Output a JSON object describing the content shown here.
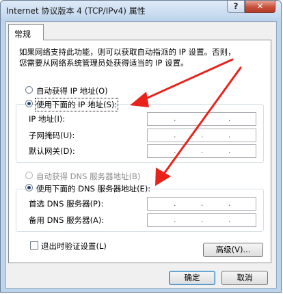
{
  "window": {
    "title": "Internet 协议版本 4 (TCP/IPv4) 属性",
    "help_glyph": "?",
    "close_glyph": "✕"
  },
  "tabs": [
    {
      "label": "常规"
    }
  ],
  "description": {
    "line1": "如果网络支持此功能，则可以获取自动指派的 IP 设置。否则，",
    "line2": "您需要从网络系统管理员处获得适当的 IP 设置。"
  },
  "ip_section": {
    "auto_label": "自动获得 IP 地址(O)",
    "manual_label": "使用下面的 IP 地址(S):",
    "selected": "manual",
    "fields": [
      {
        "label": "IP 地址(I):",
        "value": "   .   .   ."
      },
      {
        "label": "子网掩码(U):",
        "value": "   .   .   ."
      },
      {
        "label": "默认网关(D):",
        "value": "   .   .   ."
      }
    ]
  },
  "dns_section": {
    "auto_label": "自动获得 DNS 服务器地址(B)",
    "manual_label": "使用下面的 DNS 服务器地址(E):",
    "selected": "manual",
    "fields": [
      {
        "label": "首选 DNS 服务器(P):",
        "value": "   .   .   ."
      },
      {
        "label": "备用 DNS 服务器(A):",
        "value": "   .   .   ."
      }
    ]
  },
  "validate_checkbox": {
    "label": "退出时验证设置(L)",
    "checked": false
  },
  "buttons": {
    "advanced": "高级(V)...",
    "ok": "确定",
    "cancel": "取消"
  },
  "colors": {
    "arrow": "#e8231c",
    "title_bar": "#c2d7ee",
    "close_button": "#c8503a"
  }
}
